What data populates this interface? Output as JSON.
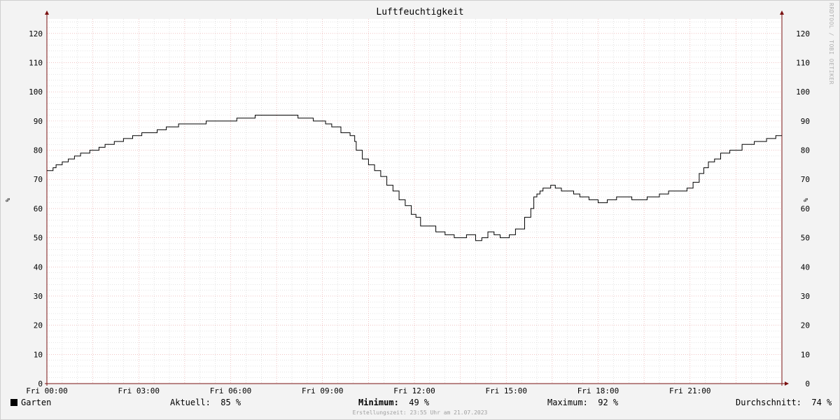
{
  "chart_data": {
    "type": "line",
    "title": "Luftfeuchtigkeit",
    "ylabel": "%",
    "xlabel": "",
    "ylim": [
      0,
      125
    ],
    "y_ticks": [
      0,
      10,
      20,
      30,
      40,
      50,
      60,
      70,
      80,
      90,
      100,
      110,
      120
    ],
    "x_ticks": [
      "Fri 00:00",
      "Fri 03:00",
      "Fri 06:00",
      "Fri 09:00",
      "Fri 12:00",
      "Fri 15:00",
      "Fri 18:00",
      "Fri 21:00"
    ],
    "x_range_hours": [
      0,
      24
    ],
    "grid": true,
    "legend": "bottom",
    "series": [
      {
        "name": "Garten",
        "color": "#000000",
        "x_hours": [
          0,
          0.2,
          0.3,
          0.5,
          0.7,
          0.9,
          1.1,
          1.4,
          1.7,
          1.9,
          2.2,
          2.5,
          2.8,
          3.1,
          3.3,
          3.6,
          3.9,
          4.3,
          4.8,
          5.2,
          5.6,
          6.2,
          6.8,
          7.3,
          7.7,
          8.2,
          8.7,
          8.9,
          9.1,
          9.3,
          9.6,
          9.9,
          10.05,
          10.1,
          10.3,
          10.5,
          10.7,
          10.9,
          11.1,
          11.3,
          11.5,
          11.7,
          11.9,
          12.05,
          12.2,
          12.4,
          12.7,
          13,
          13.3,
          13.7,
          14,
          14.2,
          14.4,
          14.6,
          14.8,
          15.1,
          15.3,
          15.6,
          15.8,
          15.9,
          16,
          16.1,
          16.2,
          16.3,
          16.45,
          16.6,
          16.8,
          17,
          17.2,
          17.4,
          17.7,
          18,
          18.3,
          18.6,
          18.8,
          19.1,
          19.6,
          20,
          20.3,
          20.6,
          20.9,
          21.1,
          21.3,
          21.45,
          21.6,
          21.8,
          22,
          22.3,
          22.7,
          23.1,
          23.5,
          23.8,
          24
        ],
        "values": [
          73,
          74,
          75,
          76,
          77,
          78,
          79,
          80,
          81,
          82,
          83,
          84,
          85,
          86,
          86,
          87,
          88,
          89,
          89,
          90,
          90,
          91,
          92,
          92,
          92,
          91,
          90,
          90,
          89,
          88,
          86,
          85,
          83,
          80,
          77,
          75,
          73,
          71,
          68,
          66,
          63,
          61,
          58,
          57,
          54,
          54,
          52,
          51,
          50,
          51,
          49,
          50,
          52,
          51,
          50,
          51,
          53,
          57,
          60,
          64,
          65,
          66,
          67,
          67,
          68,
          67,
          66,
          66,
          65,
          64,
          63,
          62,
          63,
          64,
          64,
          63,
          64,
          65,
          66,
          66,
          67,
          69,
          72,
          74,
          76,
          77,
          79,
          80,
          82,
          83,
          84,
          85,
          85
        ]
      }
    ],
    "stats": [
      {
        "label": "Aktuell:",
        "value": "85 %"
      },
      {
        "label": "Minimum:",
        "value": "49 %"
      },
      {
        "label": "Maximum:",
        "value": "92 %"
      },
      {
        "label": "Durchschnitt:",
        "value": "74 %"
      }
    ]
  },
  "watermark": "RRDTOOL / TOBI OETIKER",
  "footer": "Erstellungszeit: 23:55 Uhr am 21.07.2023",
  "colors": {
    "background": "#f3f3f3",
    "plot": "#ffffff",
    "major_grid": "#e8a0a0",
    "minor_grid": "#c8c8c8",
    "axis": "#7a1010"
  }
}
